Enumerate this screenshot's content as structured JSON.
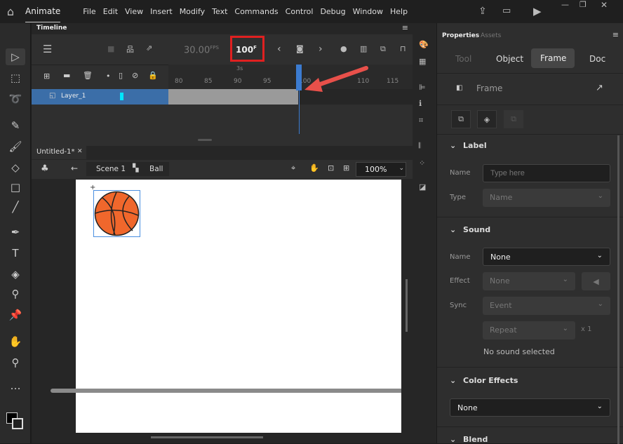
{
  "app": {
    "name": "Animate",
    "menu": [
      "File",
      "Edit",
      "View",
      "Insert",
      "Modify",
      "Text",
      "Commands",
      "Control",
      "Debug",
      "Window",
      "Help"
    ]
  },
  "timeline": {
    "title": "Timeline",
    "fps": "30.00",
    "fps_unit": "FPS",
    "frame": "100",
    "frame_unit": "F",
    "time_marker": "3s",
    "ruler": [
      "80",
      "85",
      "90",
      "95",
      "100",
      "105",
      "110",
      "115"
    ],
    "layer": "Layer_1",
    "current_frame": 100
  },
  "document": {
    "tab": "Untitled-1*",
    "scene": "Scene 1",
    "symbol": "Ball",
    "zoom": "100%"
  },
  "properties": {
    "tabs": [
      "Properties",
      "Assets"
    ],
    "subtabs": [
      "Tool",
      "Object",
      "Frame",
      "Doc"
    ],
    "active_subtab": "Frame",
    "header": "Frame",
    "label": {
      "title": "Label",
      "name_label": "Name",
      "name_placeholder": "Type here",
      "type_label": "Type",
      "type_value": "Name"
    },
    "sound": {
      "title": "Sound",
      "name_label": "Name",
      "name_value": "None",
      "effect_label": "Effect",
      "effect_value": "None",
      "sync_label": "Sync",
      "sync_value": "Event",
      "repeat_value": "Repeat",
      "repeat_count": "x 1",
      "status": "No sound selected"
    },
    "color_effects": {
      "title": "Color Effects",
      "value": "None"
    },
    "blend": {
      "title": "Blend"
    }
  },
  "colors": {
    "accent": "#3b6ea8",
    "highlight": "#e02020",
    "arrow": "#e8504a",
    "layer_color": "#00e5ff"
  }
}
